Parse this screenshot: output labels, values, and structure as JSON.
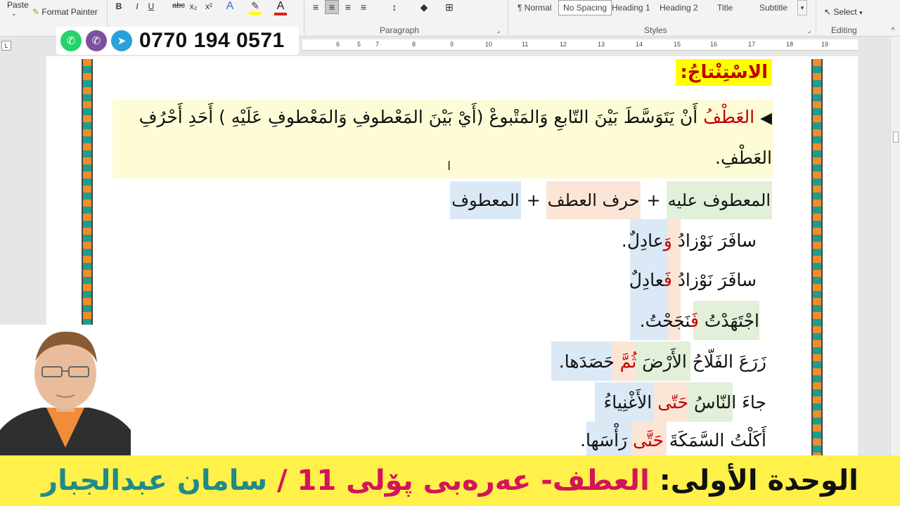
{
  "ribbon": {
    "paste": "Paste",
    "format_painter": "Format Painter",
    "bold": "B",
    "italic": "I",
    "underline": "U",
    "strike": "abc",
    "subscript": "x₂",
    "superscript": "x²",
    "paragraph_label": "Paragraph",
    "styles_label": "Styles",
    "editing_label": "Editing",
    "select": "Select",
    "styles": [
      "¶ Normal",
      "No Spacing",
      "Heading 1",
      "Heading 2",
      "Title",
      "Subtitle"
    ]
  },
  "ruler": [
    "6",
    "5",
    "7",
    "8",
    "9",
    "10",
    "11",
    "12",
    "13",
    "14",
    "15",
    "16",
    "17",
    "18",
    "19"
  ],
  "contact": {
    "phone": "0770 194 0571"
  },
  "doc": {
    "heading": "الاسْتِنْتاجُ:",
    "def_marker": "◀",
    "def_red": "العَطْفُ",
    "def_rest": " أَنْ يَتَوَسَّطَ بَيْنَ التّابعِ وَالمَتْبوعْ (أَيْ بَيْنَ المَعْطوفِ وَالمَعْطوفِ عَلَيْهِ ) أَحَدِ أَحْرُفِ",
    "def_line2": "العَطْفِ.",
    "formula": {
      "a": "المعطوف عليه",
      "plus1": "+",
      "b": "حرف العطف",
      "plus2": "+",
      "c": "المعطوف"
    },
    "examples": [
      {
        "pre": "سافَرَ نَوْزادُ ",
        "red": "وَ",
        "post": "عادِلٌ."
      },
      {
        "pre": "سافَرَ نَوْزادُ ",
        "red": "فَ",
        "post": "عادِلٌ"
      },
      {
        "pre": "اجْتَهَدْتُ ",
        "red": "فَ",
        "post": "نَجَحْتُ."
      },
      {
        "pre": "زَرَعَ الفَلّاحُ الأَرْضَ ",
        "red": "ثُمَّ",
        "post": " حَصَدَها."
      },
      {
        "pre": "جاءَ النّاسُ ",
        "red": "حَتّى",
        "post": " الأَغْنِياءُ"
      },
      {
        "pre": "أَكَلْتُ السَّمَكَةَ ",
        "red": "حَتَّى",
        "post": " رَأْسَها."
      }
    ]
  },
  "banner": {
    "part1": "الوحدة الأولى:",
    "part2": " العطف- عەرەبی پۆلی 11 /",
    "part3": " سامان عبدالجبار"
  },
  "colors": {
    "red": "#c00000",
    "banner_bg": "#fff04a",
    "whatsapp": "#25d366",
    "viber": "#7b519d",
    "telegram": "#2aa1da"
  }
}
